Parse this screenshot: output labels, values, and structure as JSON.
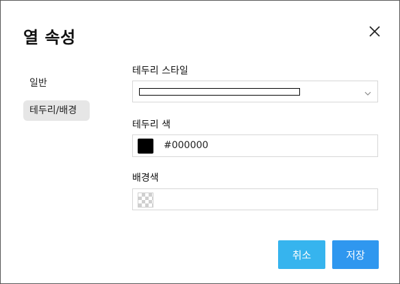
{
  "dialog": {
    "title": "열 속성",
    "close_icon": "close-icon"
  },
  "nav": {
    "items": [
      {
        "label": "일반",
        "selected": false
      },
      {
        "label": "테두리/배경",
        "selected": true
      }
    ]
  },
  "form": {
    "border_style": {
      "label": "테두리 스타일",
      "value": "solid",
      "dropdown_icon": "chevron-down-icon"
    },
    "border_color": {
      "label": "테두리 색",
      "swatch_color": "#000000",
      "value": "#000000"
    },
    "background_color": {
      "label": "배경색",
      "swatch": "transparent",
      "value": ""
    }
  },
  "buttons": {
    "cancel_label": "취소",
    "save_label": "저장",
    "cancel_color": "#36b4ee",
    "save_color": "#2f97ef"
  }
}
